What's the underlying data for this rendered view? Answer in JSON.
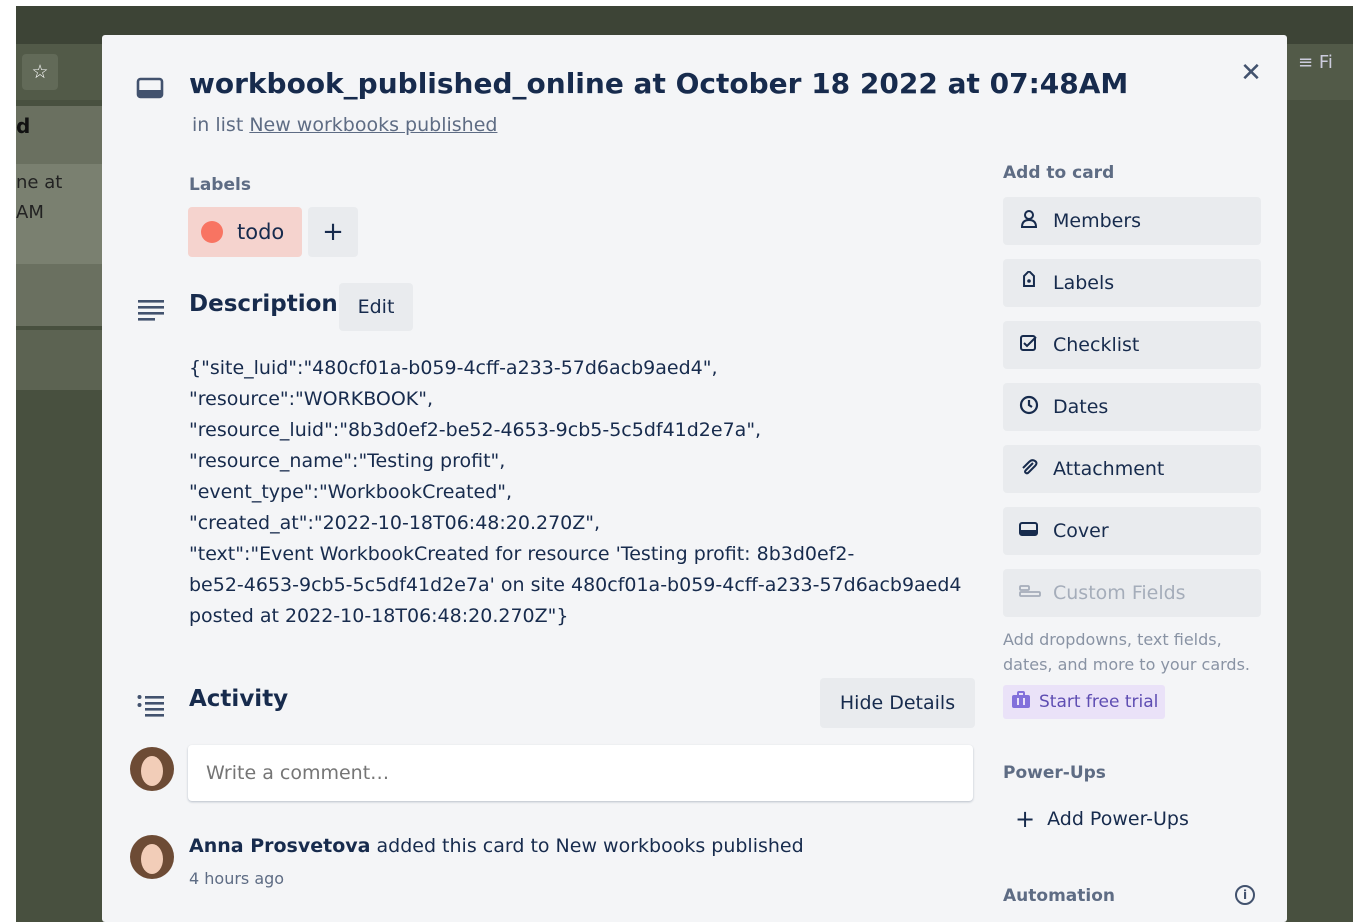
{
  "background": {
    "list_title": "d",
    "card_text_line1": "ne at",
    "card_text_line2": "AM",
    "filter_text": "Fi",
    "star_icon": "star-icon"
  },
  "card": {
    "title": "workbook_published_online at October 18 2022 at 07:48AM",
    "in_list_prefix": "in list",
    "list_name": "New workbooks published"
  },
  "labels": {
    "heading": "Labels",
    "items": [
      {
        "name": "todo",
        "color": "#f87462"
      }
    ],
    "add_symbol": "+"
  },
  "description": {
    "heading": "Description",
    "edit_label": "Edit",
    "lines": [
      "{\"site_luid\":\"480cf01a-b059-4cff-a233-57d6acb9aed4\",",
      "\"resource\":\"WORKBOOK\",",
      "\"resource_luid\":\"8b3d0ef2-be52-4653-9cb5-5c5df41d2e7a\",",
      "\"resource_name\":\"Testing profit\",",
      "\"event_type\":\"WorkbookCreated\",",
      "\"created_at\":\"2022-10-18T06:48:20.270Z\",",
      "\"text\":\"Event WorkbookCreated for resource 'Testing profit: 8b3d0ef2-",
      "be52-4653-9cb5-5c5df41d2e7a' on site 480cf01a-b059-4cff-a233-57d6acb9aed4",
      "posted at 2022-10-18T06:48:20.270Z\"}"
    ]
  },
  "activity": {
    "heading": "Activity",
    "hide_details_label": "Hide Details",
    "comment_placeholder": "Write a comment…",
    "entry_user": "Anna Prosvetova",
    "entry_action": " added this card to New workbooks published",
    "entry_time": "4 hours ago"
  },
  "sidebar": {
    "add_to_card_heading": "Add to card",
    "buttons": [
      {
        "label": "Members",
        "icon": "person-icon"
      },
      {
        "label": "Labels",
        "icon": "tag-icon"
      },
      {
        "label": "Checklist",
        "icon": "checkbox-icon"
      },
      {
        "label": "Dates",
        "icon": "clock-icon"
      },
      {
        "label": "Attachment",
        "icon": "paperclip-icon"
      },
      {
        "label": "Cover",
        "icon": "cover-icon"
      },
      {
        "label": "Custom Fields",
        "icon": "custom-fields-icon"
      }
    ],
    "custom_fields_note": "Add dropdowns, text fields, dates, and more to your cards.",
    "trial_label": "Start free trial",
    "powerups_heading": "Power-Ups",
    "add_powerups_label": "Add Power-Ups",
    "automation_heading": "Automation"
  },
  "colors": {
    "label_bg": "#f5d3ce",
    "label_dot": "#f87462",
    "modal_bg": "#f4f5f7",
    "board_bg": "#48503f"
  }
}
